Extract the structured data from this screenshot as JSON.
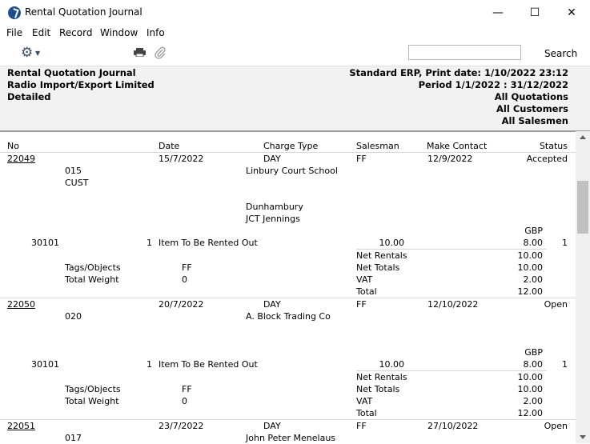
{
  "window": {
    "title": "Rental Quotation Journal",
    "minimize": "—",
    "maximize": "☐",
    "close": "✕"
  },
  "menu": [
    "File",
    "Edit",
    "Record",
    "Window",
    "Info"
  ],
  "toolbar": {
    "search_value": "",
    "search_label": "Search"
  },
  "header": {
    "left": [
      "Rental Quotation Journal",
      "Radio Import/Export Limited",
      "Detailed"
    ],
    "right": [
      "Standard ERP, Print date: 1/10/2022 23:12",
      "Period  1/1/2022 : 31/12/2022",
      "All Quotations",
      "All Customers",
      "All Salesmen"
    ]
  },
  "columns": {
    "no": "No",
    "date": "Date",
    "charge_type": "Charge Type",
    "salesman": "Salesman",
    "make_contact": "Make Contact",
    "status": "Status"
  },
  "quotations": [
    {
      "no": "22049",
      "date": "15/7/2022",
      "charge_type": "DAY",
      "salesman": "FF",
      "make_contact": "12/9/2022",
      "status": "Accepted",
      "customer_code": "015",
      "customer_name": "Linbury Court School",
      "category": "CUST",
      "address1": "Dunhambury",
      "address2": "JCT Jennings",
      "currency": "GBP",
      "item": {
        "code": "30101",
        "qty": "1",
        "desc": "Item To Be Rented Out",
        "price": "10.00",
        "sum": "8.00",
        "unit": "1"
      },
      "tags_label": "Tags/Objects",
      "tags_value": "FF",
      "weight_label": "Total Weight",
      "weight_value": "0",
      "totals": [
        {
          "label": "Net Rentals",
          "value": "10.00"
        },
        {
          "label": "Net Totals",
          "value": "10.00"
        },
        {
          "label": "VAT",
          "value": "2.00"
        },
        {
          "label": "Total",
          "value": "12.00"
        }
      ]
    },
    {
      "no": "22050",
      "date": "20/7/2022",
      "charge_type": "DAY",
      "salesman": "FF",
      "make_contact": "12/10/2022",
      "status": "Open",
      "customer_code": "020",
      "customer_name": "A. Block Trading Co",
      "currency": "GBP",
      "item": {
        "code": "30101",
        "qty": "1",
        "desc": "Item To Be Rented Out",
        "price": "10.00",
        "sum": "8.00",
        "unit": "1"
      },
      "tags_label": "Tags/Objects",
      "tags_value": "FF",
      "weight_label": "Total Weight",
      "weight_value": "0",
      "totals": [
        {
          "label": "Net Rentals",
          "value": "10.00"
        },
        {
          "label": "Net Totals",
          "value": "10.00"
        },
        {
          "label": "VAT",
          "value": "2.00"
        },
        {
          "label": "Total",
          "value": "12.00"
        }
      ]
    },
    {
      "no": "22051",
      "date": "23/7/2022",
      "charge_type": "DAY",
      "salesman": "FF",
      "make_contact": "27/10/2022",
      "status": "Open",
      "customer_code": "017",
      "customer_name": "John Peter Menelaus"
    }
  ]
}
